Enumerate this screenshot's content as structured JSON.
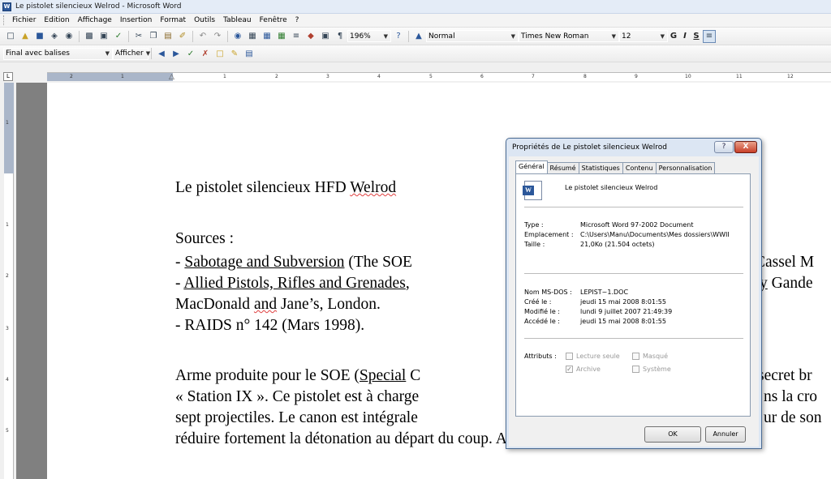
{
  "window": {
    "title": "Le pistolet silencieux Welrod - Microsoft Word",
    "app_icon": "W"
  },
  "menu": [
    "Fichier",
    "Edition",
    "Affichage",
    "Insertion",
    "Format",
    "Outils",
    "Tableau",
    "Fenêtre",
    "?"
  ],
  "toolbar": {
    "zoom": "196%",
    "style": "Normal",
    "font": "Times New Roman",
    "size": "12",
    "bold": "G",
    "italic": "I",
    "underline": "S",
    "help_icon": "?",
    "para_mark": "¶"
  },
  "review": {
    "mode": "Final avec balises",
    "show": "Afficher"
  },
  "ruler": {
    "corner": "L",
    "h_ticks": [
      "2",
      "1",
      "1",
      "2",
      "3",
      "4",
      "5",
      "6",
      "7",
      "8",
      "9",
      "10",
      "11",
      "12"
    ],
    "v_ticks": [
      "1",
      "1",
      "2",
      "3",
      "4",
      "5"
    ]
  },
  "document": {
    "title_a": "Le pistolet silencieux HFD ",
    "title_b": "Welrod",
    "sources": "Sources :",
    "l1_dash": "- ",
    "l1_link": "Sabotage and Subversion",
    "l1_rest": " (The SOE",
    "l1_right": "Cassel M",
    "l2_dash": "- ",
    "l2_link": "Allied Pistols, Rifles and Grenades",
    "l2_comma": ",",
    "l2_right_a": "y",
    "l2_right_b": " Gande",
    "l3_a": "MacDonald ",
    "l3_b": "and",
    "l3_c": " Jane’s, London.",
    "l4": "- RAIDS n° 142 (Mars 1998).",
    "p1_a": "Arme produite pour le SOE (",
    "p1_link": "Special",
    "p1_rest": " C",
    "p1_right": "secret br",
    "p2_left": "« Station IX ». Ce pistolet est à charge",
    "p2_right": "ns la cro",
    "p3_left": "sept projectiles. Le canon est intégrale",
    "p3_right": "ur de son",
    "p4": "réduire fortement la détonation au départ du coup. Ainsi, l’arme est inaudib"
  },
  "dialog": {
    "title": "Propriétés de Le pistolet silencieux Welrod",
    "help": "?",
    "close": "X",
    "tabs": [
      "Général",
      "Résumé",
      "Statistiques",
      "Contenu",
      "Personnalisation"
    ],
    "doc_name": "Le pistolet silencieux Welrod",
    "type_label": "Type :",
    "type_value": "Microsoft Word 97-2002 Document",
    "location_label": "Emplacement :",
    "location_value": "C:\\Users\\Manu\\Documents\\Mes dossiers\\WWII",
    "size_label": "Taille :",
    "size_value": "21,0Ko (21.504 octets)",
    "msdos_label": "Nom MS-DOS :",
    "msdos_value": "LEPIST~1.DOC",
    "created_label": "Créé le :",
    "created_value": "jeudi 15 mai 2008 8:01:55",
    "modified_label": "Modifié le :",
    "modified_value": "lundi 9 juillet 2007 21:49:39",
    "accessed_label": "Accédé le :",
    "accessed_value": "jeudi 15 mai 2008 8:01:55",
    "attributes_label": "Attributs :",
    "attr_readonly": "Lecture seule",
    "attr_hidden": "Masqué",
    "attr_archive": "Archive",
    "attr_system": "Système",
    "ok": "OK",
    "cancel": "Annuler"
  }
}
